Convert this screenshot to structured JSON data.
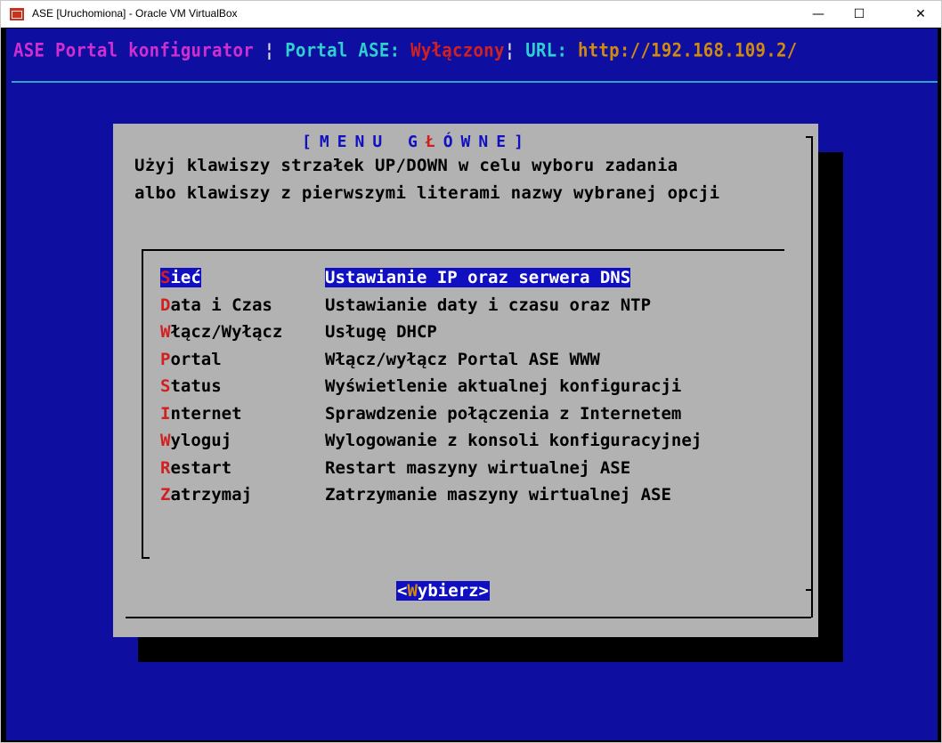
{
  "window": {
    "title": "ASE [Uruchomiona] - Oracle VM VirtualBox",
    "minimize_glyph": "—",
    "maximize_glyph": "☐",
    "close_glyph": "✕"
  },
  "statusbar": {
    "app": "ASE Portal konfigurator",
    "sep1": " ¦ ",
    "portal_label": "Portal ASE: ",
    "portal_state": "Wyłączony",
    "sep2": "¦ ",
    "url_label": "URL: ",
    "url": "http://192.168.109.2/"
  },
  "dialog": {
    "title_open": "[MENU ",
    "title_word_g": "G",
    "title_word_l": "Ł",
    "title_word_rest": "ÓWNE]",
    "instruction_line1": "Użyj klawiszy strzałek UP/DOWN w celu wyboru zadania",
    "instruction_line2": "albo klawiszy z pierwszymi literami nazwy wybranej opcji",
    "menu": [
      {
        "hot": "S",
        "rest": "ieć",
        "desc": "Ustawianie IP oraz serwera DNS",
        "selected": true
      },
      {
        "hot": "D",
        "rest": "ata i Czas",
        "desc": "Ustawianie daty i czasu oraz NTP",
        "selected": false
      },
      {
        "hot": "W",
        "rest": "łącz/Wyłącz",
        "desc": "Usługę DHCP",
        "selected": false
      },
      {
        "hot": "P",
        "rest": "ortal",
        "desc": "Włącz/wyłącz Portal ASE WWW",
        "selected": false
      },
      {
        "hot": "S",
        "rest": "tatus",
        "desc": "Wyświetlenie aktualnej konfiguracji",
        "selected": false
      },
      {
        "hot": "I",
        "rest": "nternet",
        "desc": "Sprawdzenie połączenia z Internetem",
        "selected": false
      },
      {
        "hot": "W",
        "rest": "yloguj",
        "desc": "Wylogowanie z konsoli konfiguracyjnej",
        "selected": false
      },
      {
        "hot": "R",
        "rest": "estart",
        "desc": "Restart maszyny wirtualnej ASE",
        "selected": false
      },
      {
        "hot": "Z",
        "rest": "atrzymaj",
        "desc": "Zatrzymanie maszyny wirtualnej ASE",
        "selected": false
      }
    ],
    "select_button": {
      "open": "<",
      "hot": "W",
      "rest": "ybierz",
      "close": ">"
    }
  },
  "colors": {
    "screen_bg": "#0e0fa0",
    "dialog_bg": "#b2b2b2",
    "highlight": "#1010c0",
    "hotkey": "#d22020"
  }
}
